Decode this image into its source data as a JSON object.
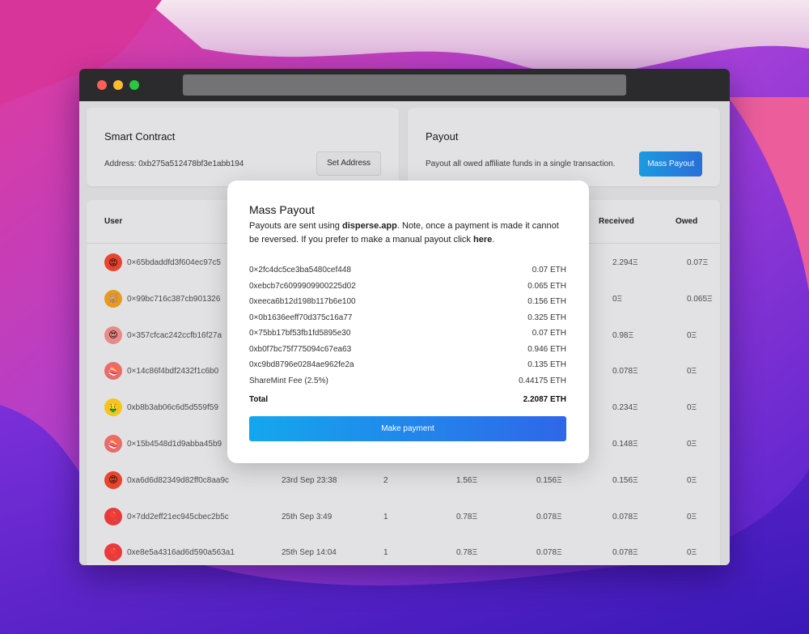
{
  "smart_contract": {
    "title": "Smart Contract",
    "address_text": "Address: 0xb275a512478bf3e1abb194",
    "set_address_label": "Set Address"
  },
  "payout": {
    "title": "Payout",
    "description": "Payout all owed affiliate funds in a single transaction.",
    "mass_payout_label": "Mass Payout"
  },
  "table": {
    "headers": {
      "user": "User",
      "received": "Received",
      "owed": "Owed"
    },
    "rows": [
      {
        "user": "0×65bdaddfd3f604ec97c5",
        "date": "",
        "count": "",
        "earned": "",
        "pending": "",
        "received": "2.294Ξ",
        "owed": "0.07Ξ",
        "avatar": "😡",
        "avatar_color": "#e8442f"
      },
      {
        "user": "0×99bc716c387cb901326",
        "date": "",
        "count": "",
        "earned": "",
        "pending": "",
        "received": "0Ξ",
        "owed": "0.065Ξ",
        "avatar": "🐒",
        "avatar_color": "#e89a1f"
      },
      {
        "user": "0×357cfcac242ccfb16f27a",
        "date": "",
        "count": "",
        "earned": "",
        "pending": "",
        "received": "0.98Ξ",
        "owed": "0Ξ",
        "avatar": "😍",
        "avatar_color": "#ea8a86"
      },
      {
        "user": "0×14c86f4bdf2432f1c6b0",
        "date": "",
        "count": "",
        "earned": "",
        "pending": "",
        "received": "0.078Ξ",
        "owed": "0Ξ",
        "avatar": "🍣",
        "avatar_color": "#ea6b6b"
      },
      {
        "user": "0xb8b3ab06c6d5d559f59",
        "date": "",
        "count": "",
        "earned": "",
        "pending": "",
        "received": "0.234Ξ",
        "owed": "0Ξ",
        "avatar": "🤑",
        "avatar_color": "#f3c51e"
      },
      {
        "user": "0×15b4548d1d9abba45b9",
        "date": "",
        "count": "",
        "earned": "",
        "pending": "",
        "received": "0.148Ξ",
        "owed": "0Ξ",
        "avatar": "🍣",
        "avatar_color": "#ea6b6b"
      },
      {
        "user": "0xa6d6d82349d82ff0c8aa9c",
        "date": "23rd Sep 23:38",
        "count": "2",
        "earned": "1.56Ξ",
        "pending": "0.156Ξ",
        "received": "0.156Ξ",
        "owed": "0Ξ",
        "avatar": "😡",
        "avatar_color": "#e8442f"
      },
      {
        "user": "0×7dd2eff21ec945cbec2b5c",
        "date": "25th Sep 3:49",
        "count": "1",
        "earned": "0.78Ξ",
        "pending": "0.078Ξ",
        "received": "0.078Ξ",
        "owed": "0Ξ",
        "avatar": "🎈",
        "avatar_color": "#e83a3a"
      },
      {
        "user": "0xe8e5a4316ad6d590a563a1",
        "date": "25th Sep 14:04",
        "count": "1",
        "earned": "0.78Ξ",
        "pending": "0.078Ξ",
        "received": "0.078Ξ",
        "owed": "0Ξ",
        "avatar": "🎈",
        "avatar_color": "#e83a3a"
      }
    ]
  },
  "modal": {
    "title": "Mass Payout",
    "desc_pre": "Payouts are sent using ",
    "desc_link": "disperse.app",
    "desc_mid": ". Note, once a payment is made it cannot be reversed. If you prefer to make a manual payout click ",
    "desc_here": "here",
    "desc_end": ".",
    "payments": [
      {
        "address": "0×2fc4dc5ce3ba5480cef448",
        "amount": "0.07 ETH"
      },
      {
        "address": "0xebcb7c6099909900225d02",
        "amount": "0.065 ETH"
      },
      {
        "address": "0xeeca6b12d198b117b6e100",
        "amount": "0.156 ETH"
      },
      {
        "address": "0×0b1636eeff70d375c16a77",
        "amount": "0.325 ETH"
      },
      {
        "address": "0×75bb17bf53fb1fd5895e30",
        "amount": "0.07 ETH"
      },
      {
        "address": "0xb0f7bc75f775094c67ea63",
        "amount": "0.946 ETH"
      },
      {
        "address": "0xc9bd8796e0284ae962fe2a",
        "amount": "0.135 ETH"
      },
      {
        "address": "ShareMint Fee (2.5%)",
        "amount": "0.44175 ETH"
      }
    ],
    "total_label": "Total",
    "total_amount": "2.2087 ETH",
    "make_payment_label": "Make payment"
  }
}
